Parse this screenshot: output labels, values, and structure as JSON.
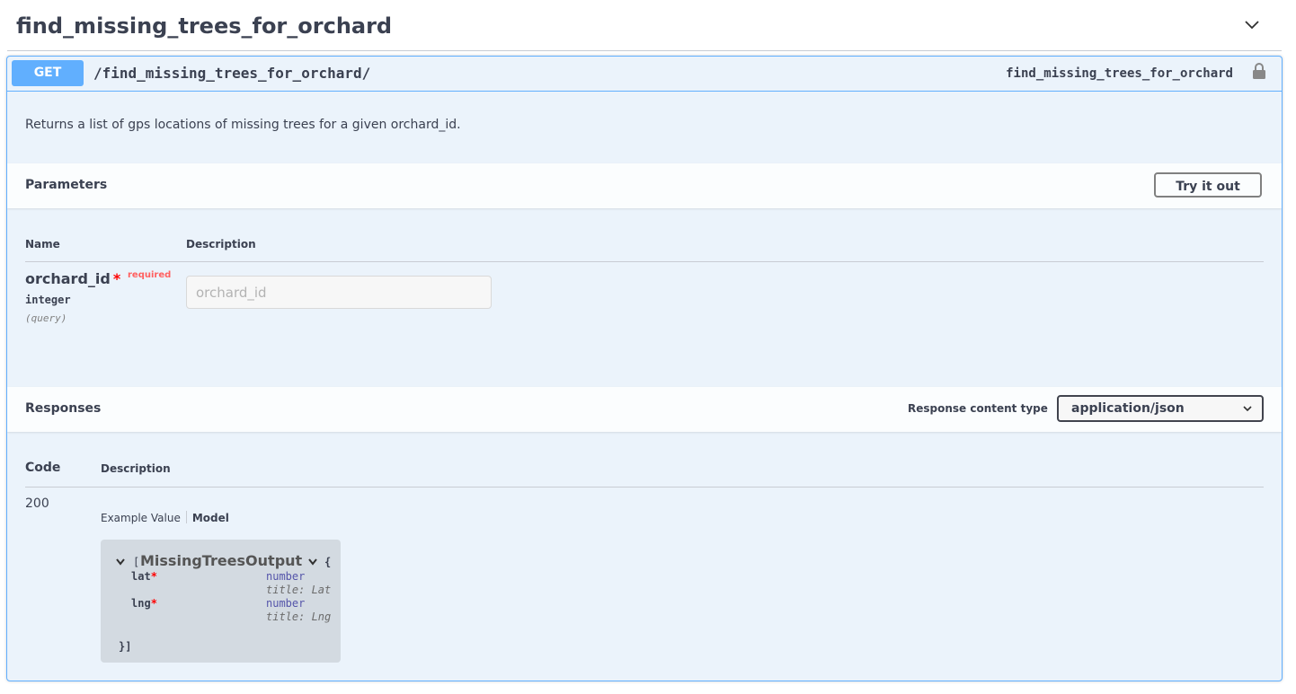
{
  "tag": {
    "title": "find_missing_trees_for_orchard"
  },
  "operation": {
    "method": "GET",
    "path": "/find_missing_trees_for_orchard/",
    "operation_id": "find_missing_trees_for_orchard",
    "description": "Returns a list of gps locations of  missing trees for a given orchard_id."
  },
  "parameters": {
    "title": "Parameters",
    "try_button": "Try it out",
    "col_name": "Name",
    "col_description": "Description",
    "items": [
      {
        "name": "orchard_id",
        "star": "*",
        "required_label": "required",
        "type": "integer",
        "in": "(query)",
        "placeholder": "orchard_id",
        "value": ""
      }
    ]
  },
  "responses": {
    "title": "Responses",
    "content_type_label": "Response content type",
    "content_type_value": "application/json",
    "col_code": "Code",
    "col_description": "Description",
    "items": [
      {
        "code": "200",
        "tab_example": "Example Value",
        "tab_model": "Model",
        "model": {
          "open_bracket": "[",
          "name": "MissingTreesOutput",
          "open_brace": "{",
          "close": "}]",
          "props": [
            {
              "name": "lat",
              "star": "*",
              "type": "number",
              "title": "title: Lat"
            },
            {
              "name": "lng",
              "star": "*",
              "type": "number",
              "title": "title: Lng"
            }
          ]
        }
      }
    ]
  }
}
